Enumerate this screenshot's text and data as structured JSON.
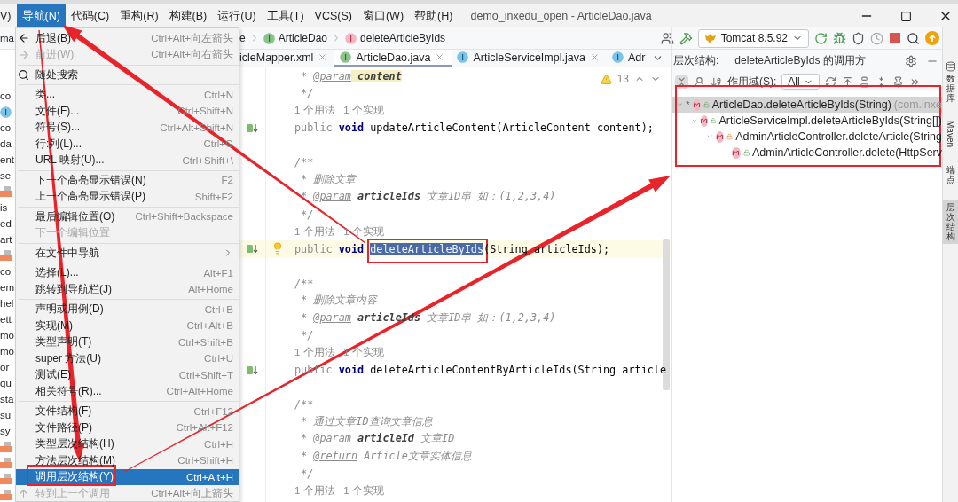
{
  "window": {
    "title": "demo_inxedu_open - ArticleDao.java"
  },
  "menu_bar": [
    {
      "label": "V)",
      "selected": false
    },
    {
      "label": "导航(N)",
      "selected": true
    },
    {
      "label": "代码(C)",
      "selected": false
    },
    {
      "label": "重构(R)",
      "selected": false
    },
    {
      "label": "构建(B)",
      "selected": false
    },
    {
      "label": "运行(U)",
      "selected": false
    },
    {
      "label": "工具(T)",
      "selected": false
    },
    {
      "label": "VCS(S)",
      "selected": false
    },
    {
      "label": "窗口(W)",
      "selected": false
    },
    {
      "label": "帮助(H)",
      "selected": false
    }
  ],
  "breadcrumb": [
    {
      "label": "e",
      "kind": "text"
    },
    {
      "label": "ArticleDao",
      "kind": "interface"
    },
    {
      "label": "deleteArticleByIds",
      "kind": "method"
    }
  ],
  "run_config": {
    "label": "Tomcat 8.5.92"
  },
  "project_tree": {
    "top": "ma",
    "items": [
      {
        "text": "co",
        "kind": "text"
      },
      {
        "kind": "enum"
      },
      {
        "text": "co",
        "kind": "text"
      },
      {
        "text": "da",
        "kind": "text"
      },
      {
        "text": "ent",
        "kind": "text"
      },
      {
        "text": "se",
        "kind": "text"
      },
      {
        "kind": "icon"
      },
      {
        "text": "is",
        "kind": "text"
      },
      {
        "text": "ed",
        "kind": "text"
      },
      {
        "text": "art",
        "kind": "text"
      },
      {
        "kind": "icon"
      },
      {
        "text": "co",
        "kind": "text"
      },
      {
        "text": "em",
        "kind": "text"
      },
      {
        "text": "hel",
        "kind": "text"
      },
      {
        "text": "ett",
        "kind": "text"
      },
      {
        "text": "mo",
        "kind": "text"
      },
      {
        "text": "mo",
        "kind": "text"
      },
      {
        "text": "or",
        "kind": "text"
      },
      {
        "text": "qu",
        "kind": "text"
      },
      {
        "text": "sta",
        "kind": "text"
      },
      {
        "text": "su",
        "kind": "text"
      },
      {
        "text": "sy",
        "kind": "text"
      },
      {
        "kind": "icon"
      },
      {
        "kind": "icon"
      },
      {
        "kind": "icon"
      },
      {
        "kind": "icon"
      }
    ]
  },
  "editor_tabs": [
    {
      "label": "icleMapper.xml",
      "kind": "xml",
      "selected": false,
      "closable": true
    },
    {
      "label": "ArticleDao.java",
      "kind": "interface",
      "selected": true,
      "closable": true
    },
    {
      "label": "ArticleServiceImpl.java",
      "kind": "class",
      "selected": false,
      "closable": true
    },
    {
      "label": "Adr",
      "kind": "class",
      "selected": false,
      "closable": false
    }
  ],
  "editor": {
    "warnings": "13",
    "lines": [
      {
        "kind": "code",
        "segments": [
          {
            "text": " * ",
            "kind": "comment"
          },
          {
            "text": "@param",
            "kind": "doctag"
          },
          {
            "text": " content",
            "kind": "docparam_hl"
          }
        ]
      },
      {
        "kind": "code",
        "segments": [
          {
            "text": " */",
            "kind": "comment"
          }
        ]
      },
      {
        "kind": "hint",
        "segments": [
          {
            "text": "1 个用法   1 个实现",
            "kind": "hint"
          }
        ]
      },
      {
        "kind": "code",
        "marker": true,
        "segments": [
          {
            "text": "public ",
            "kind": "modifier"
          },
          {
            "text": "void ",
            "kind": "kw"
          },
          {
            "text": "updateArticleContent(ArticleContent content);",
            "kind": "plain"
          }
        ]
      },
      {
        "kind": "blank"
      },
      {
        "kind": "code",
        "segments": [
          {
            "text": "/**",
            "kind": "comment"
          }
        ]
      },
      {
        "kind": "code",
        "segments": [
          {
            "text": " * 删除文章",
            "kind": "comment"
          }
        ]
      },
      {
        "kind": "code",
        "segments": [
          {
            "text": " * ",
            "kind": "comment"
          },
          {
            "text": "@param",
            "kind": "doctag"
          },
          {
            "text": " articleIds",
            "kind": "docparam"
          },
          {
            "text": " 文章ID串 如：(1,2,3,4)",
            "kind": "comment"
          }
        ]
      },
      {
        "kind": "code",
        "segments": [
          {
            "text": " */",
            "kind": "comment"
          }
        ]
      },
      {
        "kind": "hint",
        "segments": [
          {
            "text": "1 个用法   1 个实现",
            "kind": "hint"
          }
        ]
      },
      {
        "kind": "code",
        "marker": true,
        "current": true,
        "segments": [
          {
            "text": "public ",
            "kind": "modifier"
          },
          {
            "text": "void ",
            "kind": "kw"
          },
          {
            "text": "deleteArticleByIds",
            "kind": "selection"
          },
          {
            "text": "(String articleIds);",
            "kind": "plain"
          }
        ]
      },
      {
        "kind": "blank"
      },
      {
        "kind": "code",
        "segments": [
          {
            "text": "/**",
            "kind": "comment"
          }
        ]
      },
      {
        "kind": "code",
        "segments": [
          {
            "text": " * 删除文章内容",
            "kind": "comment"
          }
        ]
      },
      {
        "kind": "code",
        "segments": [
          {
            "text": " * ",
            "kind": "comment"
          },
          {
            "text": "@param",
            "kind": "doctag"
          },
          {
            "text": " articleIds",
            "kind": "docparam"
          },
          {
            "text": " 文章ID串 如：(1,2,3,4)",
            "kind": "comment"
          }
        ]
      },
      {
        "kind": "code",
        "segments": [
          {
            "text": " */",
            "kind": "comment"
          }
        ]
      },
      {
        "kind": "hint",
        "segments": [
          {
            "text": "1 个用法   1 个实现",
            "kind": "hint"
          }
        ]
      },
      {
        "kind": "code",
        "marker": true,
        "segments": [
          {
            "text": "public ",
            "kind": "modifier"
          },
          {
            "text": "void ",
            "kind": "kw"
          },
          {
            "text": "deleteArticleContentByArticleIds(String article",
            "kind": "plain"
          }
        ]
      },
      {
        "kind": "blank"
      },
      {
        "kind": "code",
        "segments": [
          {
            "text": "/**",
            "kind": "comment"
          }
        ]
      },
      {
        "kind": "code",
        "segments": [
          {
            "text": " * 通过文章ID查询文章信息",
            "kind": "comment"
          }
        ]
      },
      {
        "kind": "code",
        "segments": [
          {
            "text": " * ",
            "kind": "comment"
          },
          {
            "text": "@param",
            "kind": "doctag"
          },
          {
            "text": " articleId",
            "kind": "docparam"
          },
          {
            "text": " 文章ID",
            "kind": "comment"
          }
        ]
      },
      {
        "kind": "code",
        "segments": [
          {
            "text": " * ",
            "kind": "comment"
          },
          {
            "text": "@return",
            "kind": "doctag"
          },
          {
            "text": " Article文章实体信息",
            "kind": "comment"
          }
        ]
      },
      {
        "kind": "code",
        "segments": [
          {
            "text": " */",
            "kind": "comment"
          }
        ]
      },
      {
        "kind": "hint",
        "segments": [
          {
            "text": "1 个用法   1 个实现",
            "kind": "hint"
          }
        ]
      }
    ]
  },
  "hierarchy": {
    "title": "层次结构:",
    "subject": "deleteArticleByIds 的调用方",
    "scope_label": "作用域(S):",
    "scope": "All",
    "tree": [
      {
        "label": "ArticleDao.deleteArticleByIds(String)",
        "package": "(com.inxe",
        "mark": "*",
        "locked": false,
        "selected": true,
        "expanded": true,
        "children": [
          {
            "label": "ArticleServiceImpl.deleteArticleByIds(String[])",
            "locked": false,
            "selected": false,
            "expanded": true,
            "children": [
              {
                "label": "AdminArticleController.deleteArticle(String",
                "locked": true,
                "selected": false,
                "expanded": true,
                "children": [
                  {
                    "label": "AdminArticleController.delete(HttpServ",
                    "locked": false,
                    "selected": false
                  }
                ]
              }
            ]
          }
        ]
      }
    ]
  },
  "side_strip": [
    {
      "label": "数据库",
      "kind": "cjk",
      "selected": false
    },
    {
      "label": "Maven",
      "kind": "latin",
      "selected": false
    },
    {
      "label": "端点",
      "kind": "cjk",
      "selected": false
    },
    {
      "label": "层次结构",
      "kind": "cjk",
      "selected": true
    }
  ],
  "nav_menu": {
    "items": [
      {
        "kind": "back",
        "label": "后退(B)",
        "shortcut": "Ctrl+Alt+向左箭头",
        "disabled": false,
        "selected": false
      },
      {
        "kind": "forward",
        "label": "前进(W)",
        "shortcut": "Ctrl+Alt+向右箭头",
        "disabled": true,
        "selected": false
      },
      {
        "kind": "separator"
      },
      {
        "kind": "search",
        "label": "随处搜索",
        "disabled": false,
        "selected": false
      },
      {
        "kind": "separator"
      },
      {
        "kind": "item",
        "label": "类...",
        "shortcut": "Ctrl+N",
        "disabled": false,
        "selected": false
      },
      {
        "kind": "item",
        "label": "文件(F)...",
        "shortcut": "Ctrl+Shift+N",
        "disabled": false,
        "selected": false
      },
      {
        "kind": "item",
        "label": "符号(S)...",
        "shortcut": "Ctrl+Alt+Shift+N",
        "disabled": false,
        "selected": false
      },
      {
        "kind": "item",
        "label": "行:列(L)...",
        "shortcut": "Ctrl+G",
        "disabled": false,
        "selected": false
      },
      {
        "kind": "item",
        "label": "URL 映射(U)...",
        "shortcut": "Ctrl+Shift+\\",
        "disabled": false,
        "selected": false
      },
      {
        "kind": "separator"
      },
      {
        "kind": "item",
        "label": "下一个高亮显示错误(N)",
        "shortcut": "F2",
        "disabled": false,
        "selected": false
      },
      {
        "kind": "item",
        "label": "上一个高亮显示错误(P)",
        "shortcut": "Shift+F2",
        "disabled": false,
        "selected": false
      },
      {
        "kind": "separator"
      },
      {
        "kind": "item",
        "label": "最后编辑位置(O)",
        "shortcut": "Ctrl+Shift+Backspace",
        "disabled": false,
        "selected": false
      },
      {
        "kind": "item",
        "label": "下一个编辑位置",
        "disabled": true,
        "selected": false
      },
      {
        "kind": "separator"
      },
      {
        "kind": "submenu",
        "label": "在文件中导航",
        "disabled": false,
        "selected": false
      },
      {
        "kind": "separator"
      },
      {
        "kind": "item",
        "label": "选择(L)...",
        "shortcut": "Alt+F1",
        "disabled": false,
        "selected": false
      },
      {
        "kind": "item",
        "label": "跳转到导航栏(J)",
        "shortcut": "Alt+Home",
        "disabled": false,
        "selected": false
      },
      {
        "kind": "separator"
      },
      {
        "kind": "item",
        "label": "声明或用例(D)",
        "shortcut": "Ctrl+B",
        "disabled": false,
        "selected": false
      },
      {
        "kind": "item",
        "label": "实现(M)",
        "shortcut": "Ctrl+Alt+B",
        "disabled": false,
        "selected": false
      },
      {
        "kind": "item",
        "label": "类型声明(T)",
        "shortcut": "Ctrl+Shift+B",
        "disabled": false,
        "selected": false
      },
      {
        "kind": "item",
        "label": "super 方法(U)",
        "shortcut": "Ctrl+U",
        "disabled": false,
        "selected": false
      },
      {
        "kind": "item",
        "label": "测试(E)",
        "shortcut": "Ctrl+Shift+T",
        "disabled": false,
        "selected": false
      },
      {
        "kind": "item",
        "label": "相关符号(R)...",
        "shortcut": "Ctrl+Alt+Home",
        "disabled": false,
        "selected": false
      },
      {
        "kind": "separator"
      },
      {
        "kind": "item",
        "label": "文件结构(F)",
        "shortcut": "Ctrl+F12",
        "disabled": false,
        "selected": false
      },
      {
        "kind": "item",
        "label": "文件路径(P)",
        "shortcut": "Ctrl+Alt+F12",
        "disabled": false,
        "selected": false
      },
      {
        "kind": "item",
        "label": "类型层次结构(H)",
        "shortcut": "Ctrl+H",
        "disabled": false,
        "selected": false
      },
      {
        "kind": "item",
        "label": "方法层次结构(M)",
        "shortcut": "Ctrl+Shift+H",
        "disabled": false,
        "selected": false
      },
      {
        "kind": "item",
        "label": "调用层次结构(Y)",
        "shortcut": "Ctrl+Alt+H",
        "disabled": false,
        "selected": true
      },
      {
        "kind": "up",
        "label": "转到上一个调用",
        "shortcut": "Ctrl+Alt+向上箭头",
        "disabled": true,
        "selected": false
      }
    ]
  }
}
